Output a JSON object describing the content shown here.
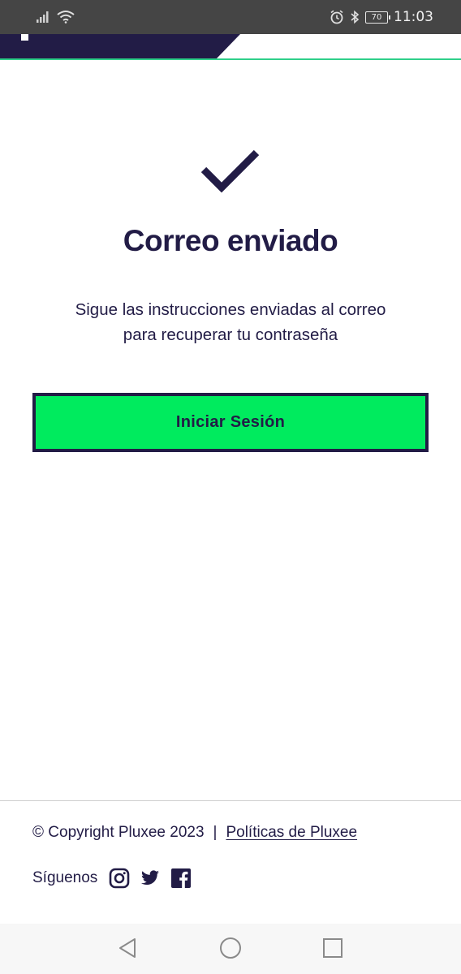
{
  "status_bar": {
    "time": "11:03",
    "battery": "70",
    "icons": [
      "signal-icon",
      "wifi-icon",
      "alarm-icon",
      "bluetooth-icon",
      "battery-icon"
    ]
  },
  "header": {
    "brand_color": "#221c46",
    "accent_color": "#2fd08a"
  },
  "main": {
    "icon": "checkmark-icon",
    "title": "Correo enviado",
    "message": "Sigue las instrucciones enviadas al correo\npara recuperar tu contraseña",
    "button_label": "Iniciar Sesión",
    "button_color": "#00eb5e"
  },
  "footer": {
    "copyright": "© Copyright Pluxee 2023",
    "separator": "|",
    "policy_link": "Políticas de Pluxee",
    "follow_label": "Síguenos",
    "social": [
      "instagram-icon",
      "twitter-icon",
      "facebook-icon"
    ]
  },
  "nav_bar": {
    "buttons": [
      "back-icon",
      "home-icon",
      "recents-icon"
    ]
  }
}
